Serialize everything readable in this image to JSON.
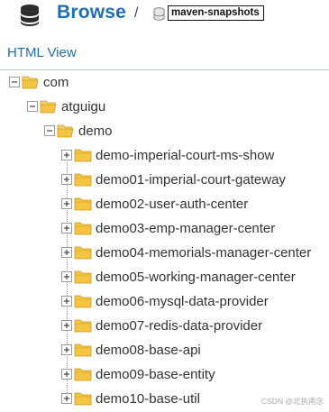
{
  "header": {
    "title": "Browse",
    "separator": "/",
    "repository": "maven-snapshots"
  },
  "tabs": [
    {
      "label": "HTML View"
    }
  ],
  "tree": {
    "root": {
      "label": "com",
      "expanded": true,
      "children": {
        "label": "atguigu",
        "expanded": true,
        "children": {
          "label": "demo",
          "expanded": true,
          "items": [
            {
              "label": "demo-imperial-court-ms-show",
              "expanded": false
            },
            {
              "label": "demo01-imperial-court-gateway",
              "expanded": false
            },
            {
              "label": "demo02-user-auth-center",
              "expanded": false
            },
            {
              "label": "demo03-emp-manager-center",
              "expanded": false
            },
            {
              "label": "demo04-memorials-manager-center",
              "expanded": false
            },
            {
              "label": "demo05-working-manager-center",
              "expanded": false
            },
            {
              "label": "demo06-mysql-data-provider",
              "expanded": false
            },
            {
              "label": "demo07-redis-data-provider",
              "expanded": false
            },
            {
              "label": "demo08-base-api",
              "expanded": false
            },
            {
              "label": "demo09-base-entity",
              "expanded": false
            },
            {
              "label": "demo10-base-util",
              "expanded": false
            }
          ]
        }
      }
    }
  },
  "watermark": "CSDN @北执南念",
  "colors": {
    "accent": "#1f6fb5",
    "folder": "#f5c443",
    "folder_outline": "#c89a20",
    "rule": "#b8c6d3"
  }
}
